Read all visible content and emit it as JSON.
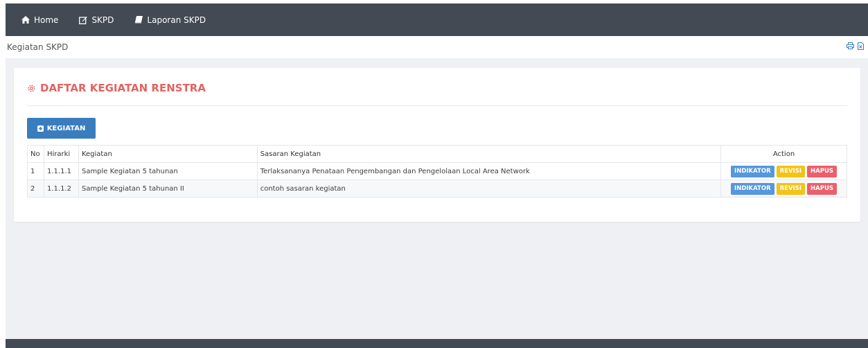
{
  "nav": {
    "items": [
      {
        "label": "Home",
        "icon": "home-icon"
      },
      {
        "label": "SKPD",
        "icon": "edit-icon"
      },
      {
        "label": "Laporan SKPD",
        "icon": "book-icon"
      }
    ]
  },
  "subbar": {
    "title": "Kegiatan SKPD",
    "tools": [
      "print-icon",
      "excel-export-icon"
    ]
  },
  "panel": {
    "title": "DAFTAR KEGIATAN RENSTRA",
    "add_button": "KEGIATAN",
    "accent": "#e46262",
    "button_color": "#3a7dbf"
  },
  "table": {
    "headers": [
      "No",
      "Hirarki",
      "Kegiatan",
      "Sasaran Kegiatan",
      "Action"
    ],
    "rows": [
      {
        "no": "1",
        "hirarki": "1.1.1.1",
        "kegiatan": "Sample Kegiatan 5 tahunan",
        "sasaran": "Terlaksananya Penataan Pengembangan dan Pengelolaan Local Area Network"
      },
      {
        "no": "2",
        "hirarki": "1.1.1.2",
        "kegiatan": "Sample Kegiatan 5 tahunan II",
        "sasaran": "contoh sasaran kegiatan"
      }
    ],
    "actions": {
      "indikator": "INDIKATOR",
      "revisi": "REVISI",
      "hapus": "HAPUS"
    },
    "action_colors": {
      "indikator": "#5598dd",
      "revisi": "#f4c314",
      "hapus": "#ec5f6b"
    }
  }
}
